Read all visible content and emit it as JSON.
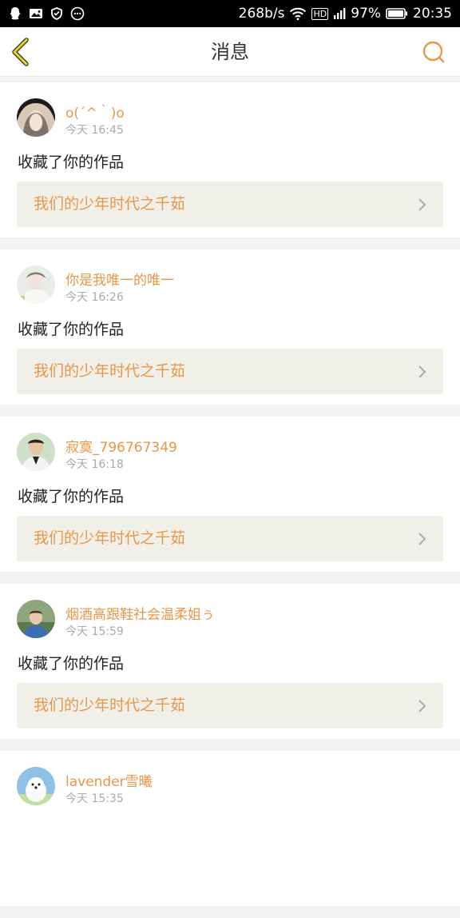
{
  "statusbar": {
    "net_speed": "268b/s",
    "battery": "97%",
    "time": "20:35",
    "network": "HD",
    "icons_left": [
      "qq-icon",
      "image-icon",
      "vpn-icon",
      "message-icon"
    ],
    "icons_right": [
      "wifi-icon",
      "signal-icon",
      "battery-icon"
    ]
  },
  "header": {
    "title": "消息",
    "back_icon": "chevron-left-icon",
    "search_icon": "search-icon"
  },
  "colors": {
    "accent": "#e8964a",
    "card_bg": "#f1f0e8",
    "page_bg": "#f3f3f3"
  },
  "messages": [
    {
      "user": "o(´^｀)o",
      "time": "今天 16:45",
      "action": "收藏了你的作品",
      "work": "我们的少年时代之千茹"
    },
    {
      "user": "你是我唯一的唯一",
      "time": "今天 16:26",
      "action": "收藏了你的作品",
      "work": "我们的少年时代之千茹"
    },
    {
      "user": "寂寞_796767349",
      "time": "今天 16:18",
      "action": "收藏了你的作品",
      "work": "我们的少年时代之千茹"
    },
    {
      "user": "烟酒高跟鞋社会温柔姐ぅ",
      "time": "今天 15:59",
      "action": "收藏了你的作品",
      "work": "我们的少年时代之千茹"
    },
    {
      "user": "lavender雪曦",
      "time": "今天 15:35"
    }
  ]
}
